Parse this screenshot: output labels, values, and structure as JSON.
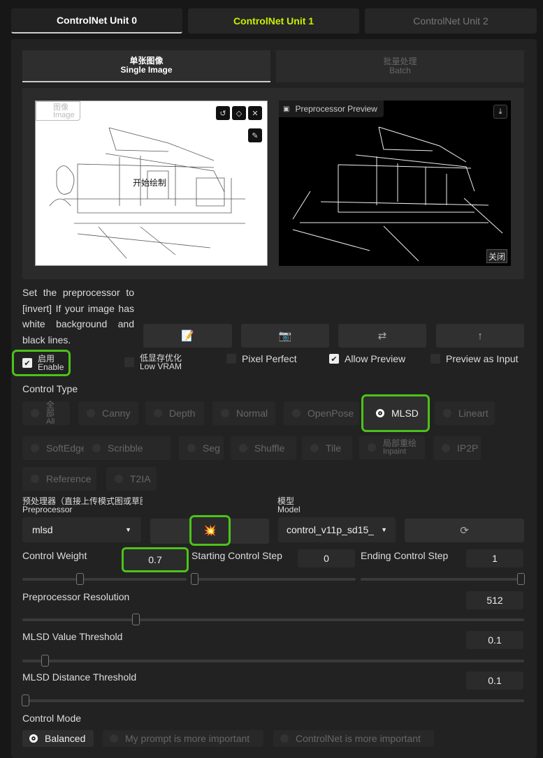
{
  "tabs": [
    {
      "label": "ControlNet Unit 0"
    },
    {
      "label": "ControlNet Unit 1"
    },
    {
      "label": "ControlNet Unit 2"
    }
  ],
  "subtabs": [
    {
      "zh": "单张图像",
      "en": "Single Image"
    },
    {
      "zh": "批量处理",
      "en": "Batch"
    }
  ],
  "image_panel": {
    "label_zh": "图像",
    "label_en": "Image",
    "overlay_text": "开始绘制"
  },
  "preview_panel": {
    "label": "Preprocessor Preview",
    "close_label": "关闭"
  },
  "hint": "Set the preprocessor to [invert] If your image has white background and black lines.",
  "checkboxes": {
    "enable": {
      "zh": "启用",
      "en": "Enable",
      "checked": true
    },
    "low_vram": {
      "zh": "低显存优化",
      "en": "Low VRAM",
      "checked": false
    },
    "pixel_perfect": {
      "label": "Pixel Perfect",
      "checked": false
    },
    "allow_preview": {
      "label": "Allow Preview",
      "checked": true
    },
    "preview_as_input": {
      "label": "Preview as Input",
      "checked": false
    }
  },
  "control_type": {
    "label": "Control Type",
    "options": [
      {
        "label": "全部",
        "sub": "All"
      },
      {
        "label": "Canny"
      },
      {
        "label": "Depth"
      },
      {
        "label": "Normal"
      },
      {
        "label": "OpenPose"
      },
      {
        "label": "MLSD",
        "selected": true
      },
      {
        "label": "Lineart"
      },
      {
        "label": "SoftEdge"
      },
      {
        "label": "Scribble"
      },
      {
        "label": "Seg"
      },
      {
        "label": "Shuffle"
      },
      {
        "label": "Tile"
      },
      {
        "label": "局部重绘",
        "sub": "Inpaint"
      },
      {
        "label": "IP2P"
      },
      {
        "label": "Reference"
      },
      {
        "label": "T2IA"
      }
    ]
  },
  "preprocessor": {
    "label_zh": "预处理器（直接上传模式图或草图",
    "label_en": "Preprocessor",
    "value": "mlsd"
  },
  "model": {
    "label_zh": "模型",
    "label_en": "Model",
    "value": "control_v11p_sd15_"
  },
  "sliders": {
    "control_weight": {
      "label": "Control Weight",
      "value": 0.7,
      "min": 0,
      "max": 2
    },
    "start_step": {
      "label": "Starting Control Step",
      "value": 0,
      "min": 0,
      "max": 1
    },
    "end_step": {
      "label": "Ending Control Step",
      "value": 1,
      "min": 0,
      "max": 1
    },
    "resolution": {
      "label": "Preprocessor Resolution",
      "value": 512,
      "min": 64,
      "max": 2048
    },
    "value_threshold": {
      "label": "MLSD Value Threshold",
      "value": 0.1,
      "min": 0.01,
      "max": 2
    },
    "distance_threshold": {
      "label": "MLSD Distance Threshold",
      "value": 0.1,
      "min": 0.01,
      "max": 20
    }
  },
  "control_mode": {
    "label": "Control Mode",
    "options": [
      {
        "label": "Balanced",
        "selected": true
      },
      {
        "label": "My prompt is more important"
      },
      {
        "label": "ControlNet is more important"
      }
    ]
  },
  "colors": {
    "highlight": "#4cc21a",
    "unit1": "#c8f000"
  }
}
